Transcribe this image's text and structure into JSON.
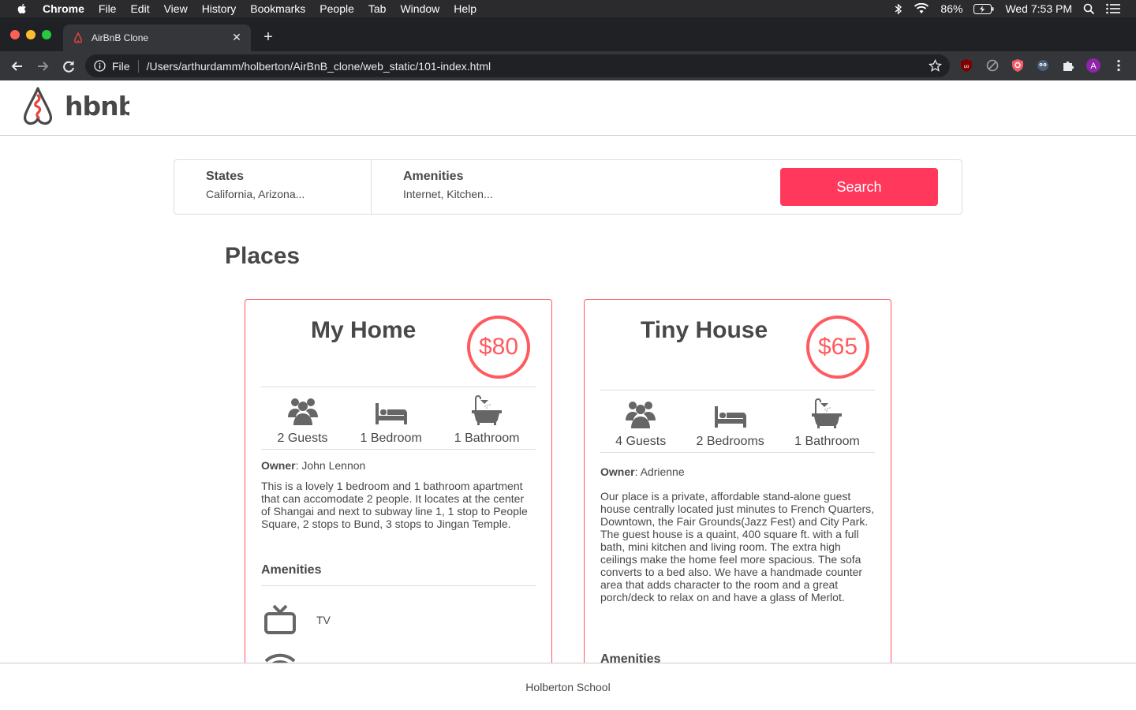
{
  "menubar": {
    "app": "Chrome",
    "items": [
      "File",
      "Edit",
      "View",
      "History",
      "Bookmarks",
      "People",
      "Tab",
      "Window",
      "Help"
    ],
    "battery": "86%",
    "clock": "Wed 7:53 PM"
  },
  "browser": {
    "tab_title": "AirBnB Clone",
    "url_scheme": "File",
    "url": "/Users/arthurdamm/holberton/AirBnB_clone/web_static/101-index.html",
    "profile_initial": "A"
  },
  "header": {
    "logo_text": "hbnb"
  },
  "filters": {
    "states_title": "States",
    "states_value": "California, Arizona...",
    "amenities_title": "Amenities",
    "amenities_value": "Internet, Kitchen...",
    "search_label": "Search"
  },
  "places_title": "Places",
  "places": [
    {
      "title": "My Home",
      "price": "$80",
      "guests": "2 Guests",
      "rooms": "1 Bedroom",
      "bathrooms": "1 Bathroom",
      "owner_label": "Owner",
      "owner": ": John Lennon",
      "description": "This is a lovely 1 bedroom and 1 bathroom apartment that can accomodate 2 people. It locates at the center of Shangai and next to subway line 1, 1 stop to People Square, 2 stops to Bund, 3 stops to Jingan Temple.",
      "amenities_title": "Amenities",
      "amenities": [
        "TV"
      ]
    },
    {
      "title": "Tiny House",
      "price": "$65",
      "guests": "4 Guests",
      "rooms": "2 Bedrooms",
      "bathrooms": "1 Bathroom",
      "owner_label": "Owner",
      "owner": ": Adrienne",
      "description": "Our place is a private, affordable stand-alone guest house centrally located just minutes to French Quarters, Downtown, the Fair Grounds(Jazz Fest) and City Park. The guest house is a quaint, 400 square ft. with a full bath, mini kitchen and living room. The extra high ceilings make the home feel more spacious. The sofa converts to a bed also. We have a handmade counter area that adds character to the room and a great porch/deck to relax on and have a glass of Merlot.",
      "amenities_title": "Amenities"
    }
  ],
  "footer": {
    "text": "Holberton School"
  },
  "colors": {
    "accent": "#ff5a5f",
    "search": "#ff385c",
    "text": "#484848"
  }
}
